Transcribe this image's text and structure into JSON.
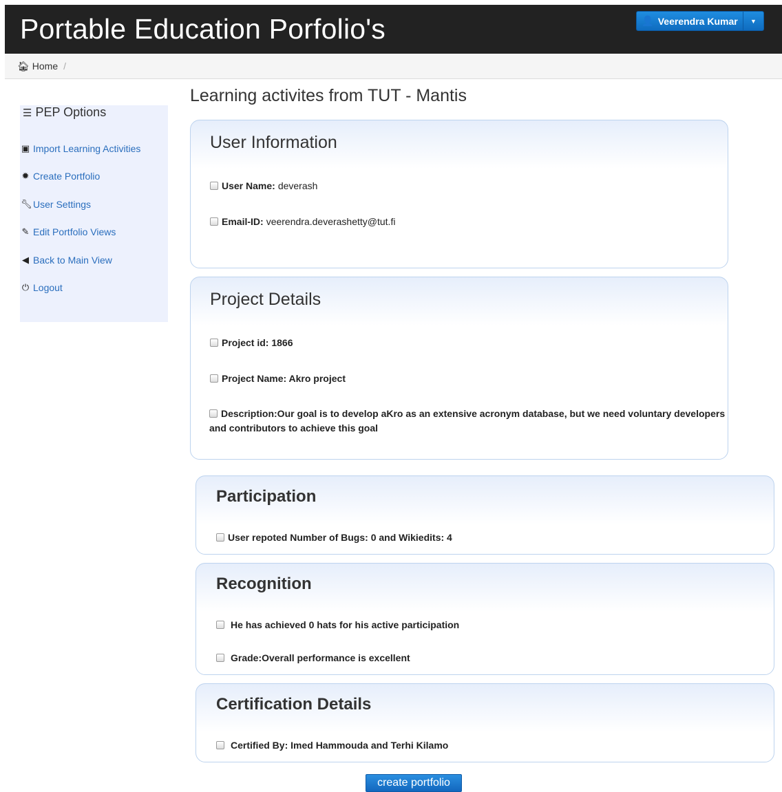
{
  "header": {
    "title": "Portable Education Porfolio's",
    "user_name": "Veerendra Kumar",
    "user_icon": "user-icon",
    "dropdown_icon": "caret-down-icon"
  },
  "breadcrumb": {
    "home": "Home",
    "separator": "/"
  },
  "sidebar": {
    "title": "PEP Options",
    "items": [
      {
        "label": "Import Learning Activities",
        "icon": "inbox-icon"
      },
      {
        "label": "Create Portfolio",
        "icon": "certificate-icon"
      },
      {
        "label": "User Settings",
        "icon": "wrench-icon"
      },
      {
        "label": "Edit Portfolio Views",
        "icon": "edit-icon"
      },
      {
        "label": "Back to Main View",
        "icon": "back-arrow-icon"
      },
      {
        "label": "Logout",
        "icon": "power-icon"
      }
    ]
  },
  "main": {
    "heading": "Learning activites from TUT - Mantis",
    "user_info": {
      "title": "User Information",
      "username_label": "User Name:",
      "username_value": "deverash",
      "email_label": "Email-ID:",
      "email_value": "veerendra.deverashetty@tut.fi"
    },
    "project": {
      "title": "Project Details",
      "id": "Project id: 1866",
      "name": "Project Name: Akro project",
      "description": "Description:Our goal is to develop aKro as an extensive acronym database, but we need voluntary developers and contributors to achieve this goal"
    },
    "participation": {
      "title": "Participation",
      "item": "User repoted Number of Bugs: 0 and Wikiedits: 4"
    },
    "recognition": {
      "title": "Recognition",
      "hats": "He has achieved 0 hats for his active participation",
      "grade": "Grade:Overall performance is excellent"
    },
    "certification": {
      "title": "Certification Details",
      "certified_by": "Certified By: Imed Hammouda and Terhi Kilamo"
    },
    "create_button": "create portfolio"
  }
}
